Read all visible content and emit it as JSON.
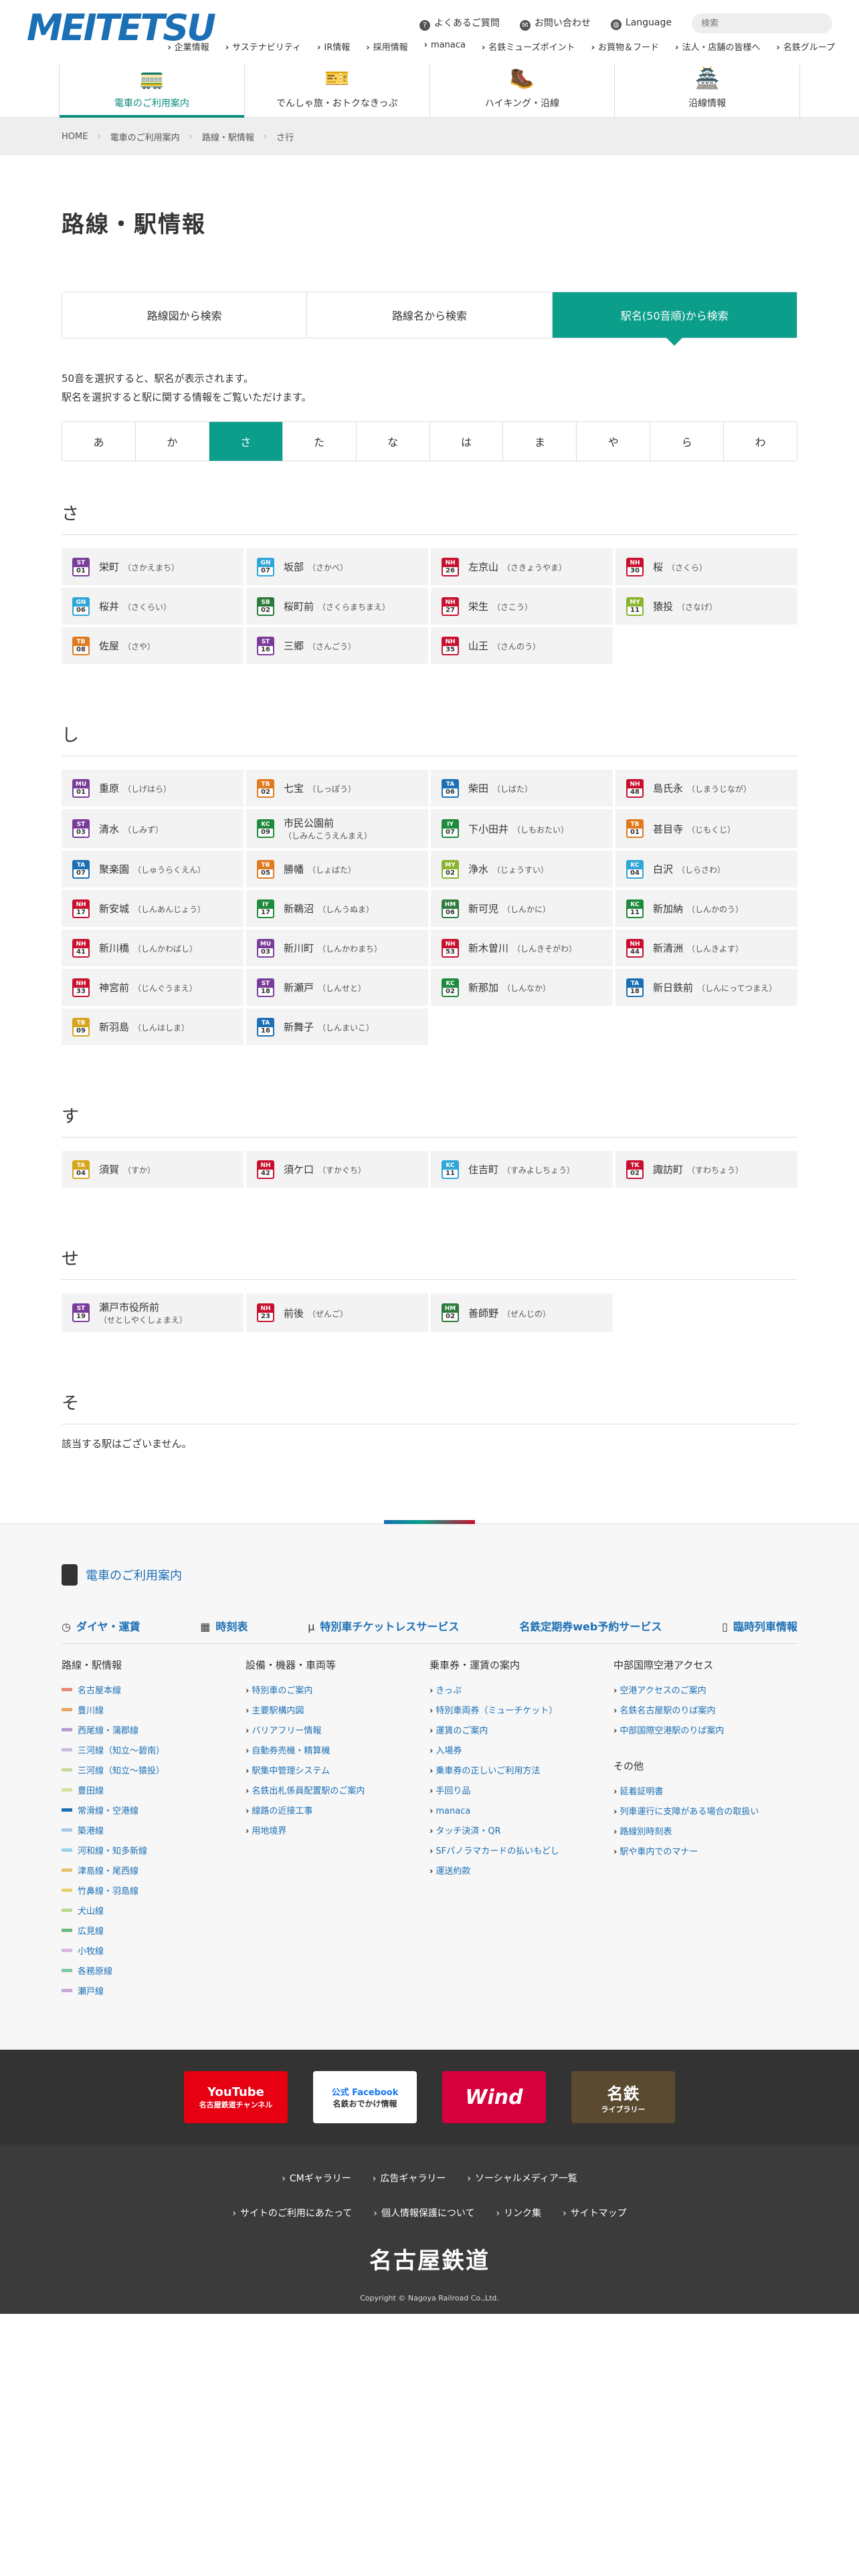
{
  "header": {
    "logo": "MEITETSU",
    "util": [
      "よくあるご質問",
      "お問い合わせ",
      "Language"
    ],
    "search_placeholder": "検索",
    "subnav": [
      "企業情報",
      "サステナビリティ",
      "IR情報",
      "採用情報",
      "manaca",
      "名鉄ミューズポイント",
      "お買物＆フード",
      "法人・店舗の皆様へ",
      "名鉄グループ"
    ],
    "gnav": [
      "電車のご利用案内",
      "でんしゃ旅・おトクなきっぷ",
      "ハイキング・沿線",
      "沿線情報"
    ]
  },
  "breadcrumb": [
    "HOME",
    "電車のご利用案内",
    "路線・駅情報",
    "さ行"
  ],
  "page_title": "路線・駅情報",
  "tabs": [
    "路線図から検索",
    "路線名から検索",
    "駅名(50音順)から検索"
  ],
  "note": [
    "50音を選択すると、駅名が表示されます。",
    "駅名を選択すると駅に関する情報をご覧いただけます。"
  ],
  "kana": [
    "あ",
    "か",
    "さ",
    "た",
    "な",
    "は",
    "ま",
    "や",
    "ら",
    "わ"
  ],
  "sections": [
    {
      "head": "さ",
      "stations": [
        {
          "code": "ST",
          "num": "01",
          "color": "c-purple",
          "name": "栄町",
          "yomi": "（さかえまち）"
        },
        {
          "code": "GN",
          "num": "07",
          "color": "c-cyan",
          "name": "坂部",
          "yomi": "（さかべ）"
        },
        {
          "code": "NH",
          "num": "26",
          "color": "c-red",
          "name": "左京山",
          "yomi": "（さきょうやま）"
        },
        {
          "code": "NH",
          "num": "30",
          "color": "c-red",
          "name": "桜",
          "yomi": "（さくら）"
        },
        {
          "code": "GN",
          "num": "06",
          "color": "c-cyan",
          "name": "桜井",
          "yomi": "（さくらい）"
        },
        {
          "code": "SB",
          "num": "02",
          "color": "c-dgreen",
          "name": "桜町前",
          "yomi": "（さくらまちまえ）"
        },
        {
          "code": "NH",
          "num": "27",
          "color": "c-red",
          "name": "栄生",
          "yomi": "（さこう）"
        },
        {
          "code": "MY",
          "num": "11",
          "color": "c-ygreen",
          "name": "猿投",
          "yomi": "（さなげ）"
        },
        {
          "code": "TB",
          "num": "08",
          "color": "c-orange",
          "name": "佐屋",
          "yomi": "（さや）"
        },
        {
          "code": "ST",
          "num": "16",
          "color": "c-purple",
          "name": "三郷",
          "yomi": "（さんごう）"
        },
        {
          "code": "NH",
          "num": "35",
          "color": "c-red",
          "name": "山王",
          "yomi": "（さんのう）"
        }
      ]
    },
    {
      "head": "し",
      "stations": [
        {
          "code": "MU",
          "num": "01",
          "color": "c-purple",
          "name": "重原",
          "yomi": "（しげはら）"
        },
        {
          "code": "TB",
          "num": "02",
          "color": "c-orange",
          "name": "七宝",
          "yomi": "（しっぽう）"
        },
        {
          "code": "TA",
          "num": "06",
          "color": "c-blue",
          "name": "柴田",
          "yomi": "（しばた）"
        },
        {
          "code": "NH",
          "num": "48",
          "color": "c-red",
          "name": "島氏永",
          "yomi": "（しまうじなが）"
        },
        {
          "code": "ST",
          "num": "03",
          "color": "c-purple",
          "name": "清水",
          "yomi": "（しみず）"
        },
        {
          "code": "KC",
          "num": "09",
          "color": "c-green",
          "name": "市民公園前",
          "yomi": "（しみんこうえんまえ）",
          "wrap": true
        },
        {
          "code": "IY",
          "num": "07",
          "color": "c-green",
          "name": "下小田井",
          "yomi": "（しもおたい）"
        },
        {
          "code": "TB",
          "num": "01",
          "color": "c-orange",
          "name": "甚目寺",
          "yomi": "（じもくじ）"
        },
        {
          "code": "TA",
          "num": "07",
          "color": "c-blue",
          "name": "聚楽園",
          "yomi": "（しゅうらくえん）"
        },
        {
          "code": "TB",
          "num": "05",
          "color": "c-orange",
          "name": "勝幡",
          "yomi": "（しょばた）"
        },
        {
          "code": "MY",
          "num": "02",
          "color": "c-ygreen",
          "name": "浄水",
          "yomi": "（じょうすい）"
        },
        {
          "code": "KC",
          "num": "04",
          "color": "c-cyan",
          "name": "白沢",
          "yomi": "（しらさわ）"
        },
        {
          "code": "NH",
          "num": "17",
          "color": "c-red",
          "name": "新安城",
          "yomi": "（しんあんじょう）"
        },
        {
          "code": "IY",
          "num": "17",
          "color": "c-green",
          "name": "新鵜沼",
          "yomi": "（しんうぬま）"
        },
        {
          "code": "HM",
          "num": "06",
          "color": "c-dgreen",
          "name": "新可児",
          "yomi": "（しんかに）"
        },
        {
          "code": "KC",
          "num": "11",
          "color": "c-green",
          "name": "新加納",
          "yomi": "（しんかのう）"
        },
        {
          "code": "NH",
          "num": "41",
          "color": "c-red",
          "name": "新川橋",
          "yomi": "（しんかわばし）"
        },
        {
          "code": "MU",
          "num": "03",
          "color": "c-purple",
          "name": "新川町",
          "yomi": "（しんかわまち）"
        },
        {
          "code": "NH",
          "num": "53",
          "color": "c-red",
          "name": "新木曽川",
          "yomi": "（しんきそがわ）"
        },
        {
          "code": "NH",
          "num": "44",
          "color": "c-red",
          "name": "新清洲",
          "yomi": "（しんきよす）"
        },
        {
          "code": "NH",
          "num": "33",
          "color": "c-red",
          "name": "神宮前",
          "yomi": "（じんぐうまえ）"
        },
        {
          "code": "ST",
          "num": "18",
          "color": "c-purple",
          "name": "新瀬戸",
          "yomi": "（しんせと）"
        },
        {
          "code": "KC",
          "num": "02",
          "color": "c-green",
          "name": "新那加",
          "yomi": "（しんなか）"
        },
        {
          "code": "TA",
          "num": "18",
          "color": "c-blue",
          "name": "新日鉄前",
          "yomi": "（しんにってつまえ）"
        },
        {
          "code": "TB",
          "num": "09",
          "color": "c-mustard",
          "name": "新羽島",
          "yomi": "（しんはしま）"
        },
        {
          "code": "TA",
          "num": "16",
          "color": "c-blue",
          "name": "新舞子",
          "yomi": "（しんまいこ）"
        }
      ]
    },
    {
      "head": "す",
      "stations": [
        {
          "code": "TA",
          "num": "04",
          "color": "c-mustard",
          "name": "須賀",
          "yomi": "（すか）"
        },
        {
          "code": "NH",
          "num": "42",
          "color": "c-red",
          "name": "須ケ口",
          "yomi": "（すかぐち）"
        },
        {
          "code": "KC",
          "num": "11",
          "color": "c-cyan",
          "name": "住吉町",
          "yomi": "（すみよしちょう）"
        },
        {
          "code": "TK",
          "num": "02",
          "color": "c-red",
          "name": "諏訪町",
          "yomi": "（すわちょう）"
        }
      ]
    },
    {
      "head": "せ",
      "stations": [
        {
          "code": "ST",
          "num": "19",
          "color": "c-purple",
          "name": "瀬戸市役所前",
          "yomi": "（せとしやくしょまえ）",
          "wrap": true
        },
        {
          "code": "NH",
          "num": "23",
          "color": "c-red",
          "name": "前後",
          "yomi": "（ぜんご）"
        },
        {
          "code": "HM",
          "num": "02",
          "color": "c-dgreen",
          "name": "善師野",
          "yomi": "（ぜんじの）"
        }
      ]
    },
    {
      "head": "そ",
      "stations": [],
      "empty": "該当する駅はございません。"
    }
  ],
  "footer": {
    "title": "電車のご利用案内",
    "links": [
      "ダイヤ・運賃",
      "時刻表",
      "特別車チケットレスサービス",
      "名鉄定期券web予約サービス",
      "臨時列車情報"
    ],
    "col1_title": "路線・駅情報",
    "lines": [
      {
        "name": "名古屋本線",
        "color": "#e88b7a"
      },
      {
        "name": "豊川線",
        "color": "#e8a860"
      },
      {
        "name": "西尾線・蒲郡線",
        "color": "#b89ad0"
      },
      {
        "name": "三河線（知立〜碧南）",
        "color": "#c9b8e0"
      },
      {
        "name": "三河線（知立〜猿投）",
        "color": "#c9d8a0"
      },
      {
        "name": "豊田線",
        "color": "#d8e0a0"
      },
      {
        "name": "常滑線・空港線",
        "color": "#1c6fb5"
      },
      {
        "name": "築港線",
        "color": "#a8c8e8"
      },
      {
        "name": "河和線・知多新線",
        "color": "#9ad0e8"
      },
      {
        "name": "津島線・尾西線",
        "color": "#e8c070"
      },
      {
        "name": "竹鼻線・羽島線",
        "color": "#e8d070"
      },
      {
        "name": "犬山線",
        "color": "#b8d890"
      },
      {
        "name": "広見線",
        "color": "#70b880"
      },
      {
        "name": "小牧線",
        "color": "#d8b8e0"
      },
      {
        "name": "各務原線",
        "color": "#80c8a8"
      },
      {
        "name": "瀬戸線",
        "color": "#c8a8d8"
      }
    ],
    "col2_title": "設備・機器・車両等",
    "col2": [
      "特別車のご案内",
      "主要駅構内図",
      "バリアフリー情報",
      "自動券売機・精算機",
      "駅集中管理システム",
      "名鉄出札係員配置駅のご案内",
      "線路の近接工事",
      "用地境界"
    ],
    "col3_title": "乗車券・運賃の案内",
    "col3": [
      "きっぷ",
      "特別車両券（ミューチケット）",
      "運賃のご案内",
      "入場券",
      "乗車券の正しいご利用方法",
      "手回り品",
      "manaca",
      "タッチ決済・QR",
      "SFパノラマカードの払いもどし",
      "運送約款"
    ],
    "col4_title": "中部国際空港アクセス",
    "col4": [
      "空港アクセスのご案内",
      "名鉄名古屋駅のりば案内",
      "中部国際空港駅のりば案内"
    ],
    "col4b_title": "その他",
    "col4b": [
      "延着証明書",
      "列車運行に支障がある場合の取扱い",
      "路線別時刻表",
      "駅や車内でのマナー"
    ]
  },
  "banners": [
    "YouTube",
    "名古屋鉄道チャンネル",
    "公式 Facebook",
    "名鉄おでかけ情報",
    "Wind",
    "名鉄",
    "ライブラリー"
  ],
  "bottom": {
    "row1": [
      "CMギャラリー",
      "広告ギャラリー",
      "ソーシャルメディア一覧"
    ],
    "row2": [
      "サイトのご利用にあたって",
      "個人情報保護について",
      "リンク集",
      "サイトマップ"
    ],
    "name": "名古屋鉄道",
    "copy": "Copyright © Nagoya Railroad Co.,Ltd."
  }
}
